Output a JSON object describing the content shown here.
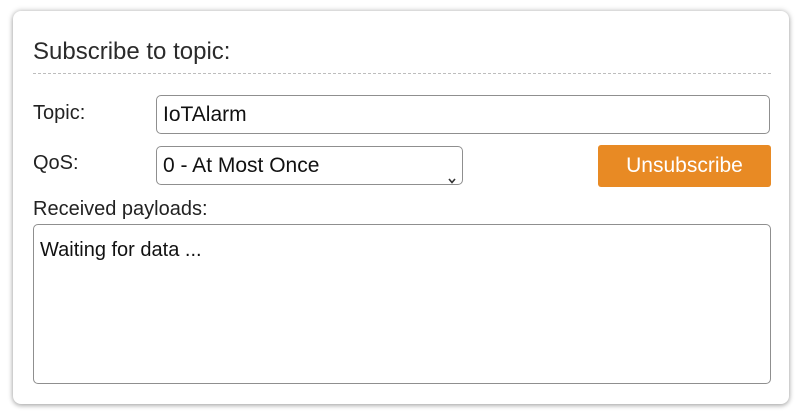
{
  "panel": {
    "title": "Subscribe to topic:"
  },
  "topic": {
    "label": "Topic:",
    "value": "IoTAlarm"
  },
  "qos": {
    "label": "QoS:",
    "selected": "0 - At Most Once"
  },
  "unsubscribe_button": {
    "label": "Unsubscribe",
    "color": "#e88a24"
  },
  "payloads": {
    "label": "Received payloads:",
    "content": "Waiting for data ..."
  }
}
